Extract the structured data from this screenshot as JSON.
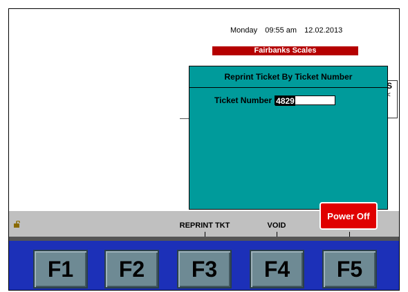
{
  "header": {
    "day": "Monday",
    "time": "09:55 am",
    "date": "12.02.2013",
    "brand": "Fairbanks Scales"
  },
  "background_fragment": {
    "line1": "S",
    "line2": "<"
  },
  "dialog": {
    "title": "Reprint Ticket By Ticket Number",
    "ticket_label": "Ticket Number",
    "ticket_value": "4829"
  },
  "status_bar": {
    "function_labels": [
      "",
      "",
      "REPRINT TKT",
      "VOID",
      ""
    ]
  },
  "power_button": {
    "label": "Power Off"
  },
  "function_keys": [
    "F1",
    "F2",
    "F3",
    "F4",
    "F5"
  ],
  "colors": {
    "dialog_bg": "#009b9b",
    "brand_bg": "#b50000",
    "power_bg": "#e00000",
    "fkey_bar_bg": "#1c30b8",
    "fkey_bg": "#6e8a94"
  },
  "icons": {
    "status_icon": "padlock-open-icon"
  }
}
